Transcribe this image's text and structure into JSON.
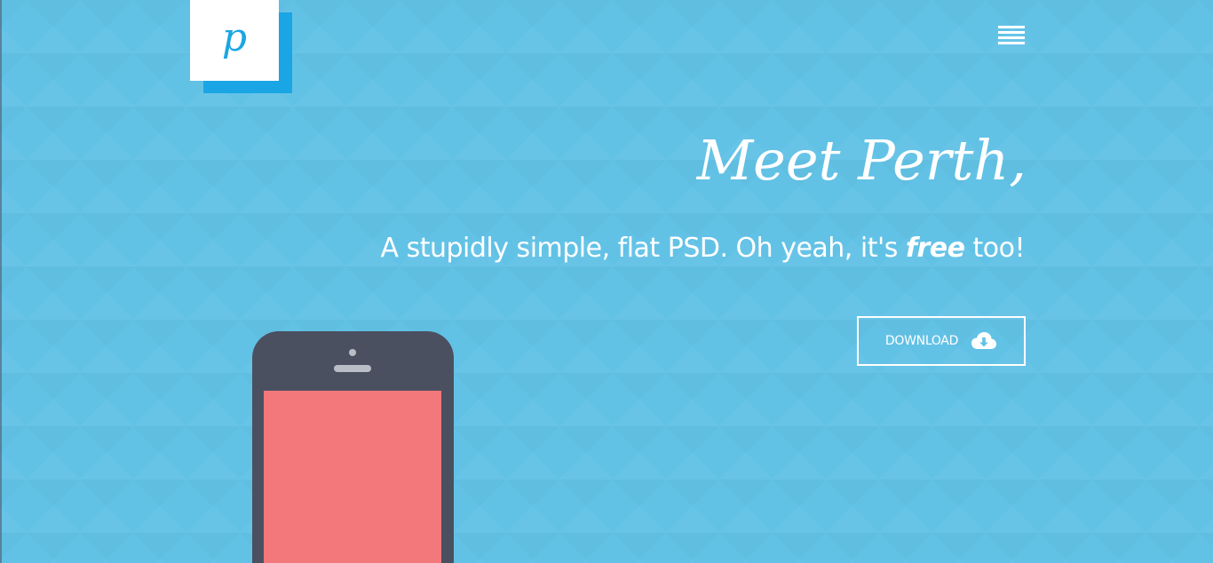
{
  "logo": {
    "letter": "p",
    "icon": "perth-logo-icon"
  },
  "nav": {
    "menu_icon": "hamburger-menu-icon"
  },
  "hero": {
    "title": "Meet Perth,",
    "subtitle_before": "A stupidly simple, flat PSD. Oh yeah, it's ",
    "subtitle_emphasis": "free",
    "subtitle_after": " too!"
  },
  "download": {
    "label": "DOWNLOAD",
    "icon": "cloud-download-icon"
  },
  "illustration": {
    "device": "phone-illustration"
  },
  "colors": {
    "background": "#62c2e6",
    "logo_accent": "#1aa6e4",
    "phone_body": "#4b5060",
    "phone_screen": "#f2787b",
    "text": "#ffffff"
  }
}
